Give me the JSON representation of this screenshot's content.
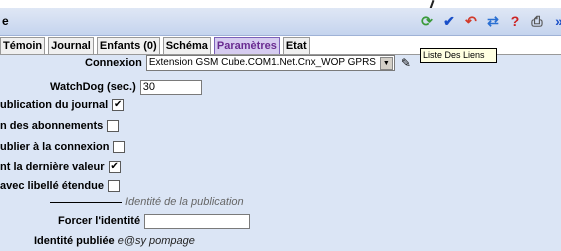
{
  "window": {
    "title": "e"
  },
  "toolbar": {
    "buttons": [
      {
        "icon": "refresh-icon",
        "glyph": "⟳",
        "color": "#3a9a3a"
      },
      {
        "icon": "check-icon",
        "glyph": "✔",
        "color": "#1a4fc8"
      },
      {
        "icon": "undo-icon",
        "glyph": "↶",
        "color": "#d23a2a"
      },
      {
        "icon": "sync-icon",
        "glyph": "⇄",
        "color": "#2a6fd2"
      },
      {
        "icon": "help-icon",
        "glyph": "?",
        "color": "#cc2222"
      },
      {
        "icon": "print-icon",
        "glyph": "⎙",
        "color": "#555555"
      },
      {
        "icon": "expand-icon",
        "glyph": "»",
        "color": "#1a4fc8"
      }
    ]
  },
  "tooltip": {
    "text": "Liste Des Liens"
  },
  "tabs": [
    {
      "label": "Témoin",
      "active": false
    },
    {
      "label": "Journal",
      "active": false
    },
    {
      "label": "Enfants (0)",
      "active": false
    },
    {
      "label": "Schéma",
      "active": false
    },
    {
      "label": "Paramètres",
      "active": true
    },
    {
      "label": "Etat",
      "active": false
    }
  ],
  "form": {
    "connexion_label": "Connexion",
    "connexion_value": "Extension GSM Cube.COM1.Net.Cnx_WOP GPRS",
    "watchdog_label": "WatchDog (sec.)",
    "watchdog_value": "30",
    "checkboxes": [
      {
        "label": "ublication du journal",
        "checked": true
      },
      {
        "label": "n des abonnements",
        "checked": false
      },
      {
        "label": "ublier à la connexion",
        "checked": false
      },
      {
        "label": "nt la dernière valeur",
        "checked": true
      },
      {
        "label": "avec libellé étendue",
        "checked": false
      }
    ],
    "section_title": "Identité de la publication",
    "forcer_label": "Forcer l'identité",
    "forcer_value": "",
    "identite_label": "Identité publiée",
    "identite_value": "e@sy pompage"
  },
  "colors": {
    "panel_bg": "#dbe5f5",
    "active_tab": "#6a2c91"
  }
}
